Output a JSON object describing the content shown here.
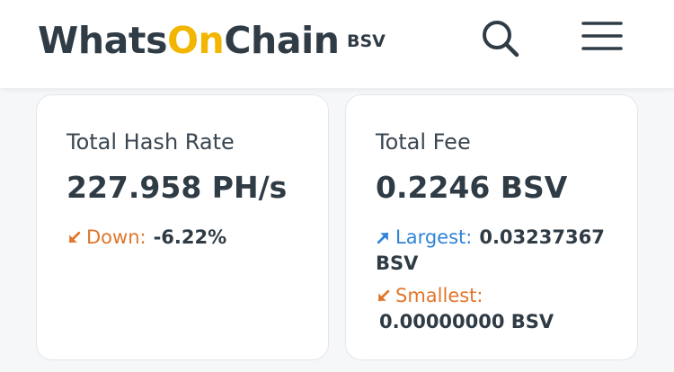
{
  "header": {
    "logo_part1": "Whats",
    "logo_part2": "On",
    "logo_part3": "Chain",
    "network": "BSV"
  },
  "colors": {
    "logo_accent": "#f2b600",
    "down_orange": "#e0762b",
    "up_blue": "#2f83d8",
    "text_dark": "#2f3b45"
  },
  "hash_rate": {
    "title": "Total Hash Rate",
    "value": "227.958 PH/s",
    "trend_label": "Down:",
    "trend_value": "-6.22%",
    "trend_icon": "arrow-down-left-icon"
  },
  "fee": {
    "title": "Total Fee",
    "value": "0.2246 BSV",
    "largest_label": "Largest:",
    "largest_value": "0.03237367",
    "largest_unit": "BSV",
    "largest_icon": "arrow-up-right-icon",
    "smallest_label": "Smallest:",
    "smallest_value": "0.00000000 BSV",
    "smallest_icon": "arrow-down-left-icon"
  }
}
